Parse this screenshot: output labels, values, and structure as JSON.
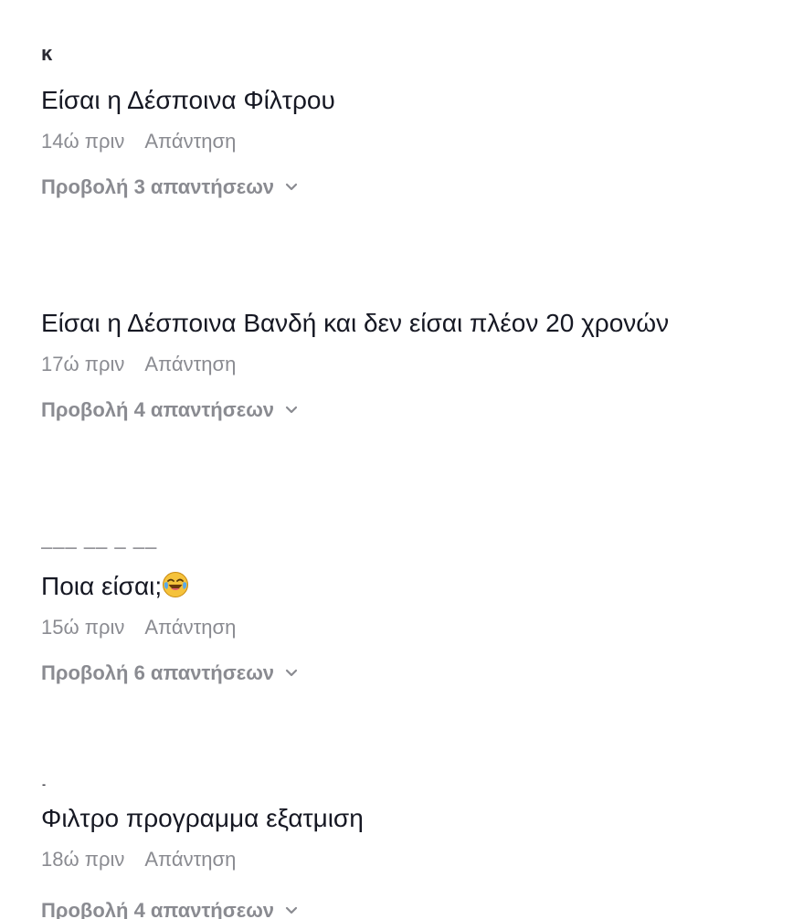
{
  "comments": [
    {
      "text": "Είσαι η Δέσποινα Φίλτρου",
      "time": "14ώ πριν",
      "reply_label": "Απάντηση",
      "view_replies": "Προβολή 3 απαντήσεων"
    },
    {
      "text": "Είσαι η Δέσποινα Βανδή και δεν είσαι πλέον 20 χρονών",
      "time": "17ώ πριν",
      "reply_label": "Απάντηση",
      "view_replies": "Προβολή 4 απαντήσεων"
    },
    {
      "text": "Ποια είσαι;",
      "emoji": "face-with-tears-of-joy-icon",
      "time": "15ώ πριν",
      "reply_label": "Απάντηση",
      "view_replies": "Προβολή 6 απαντήσεων"
    },
    {
      "text": "Φιλτρο προγραμμα εξατμιση",
      "time": "18ώ πριν",
      "reply_label": "Απάντηση",
      "view_replies": "Προβολή 4 απαντήσεων"
    }
  ],
  "colors": {
    "text": "#161823",
    "secondary": "#8a8b91",
    "emoji_face": "#f5c23b"
  }
}
